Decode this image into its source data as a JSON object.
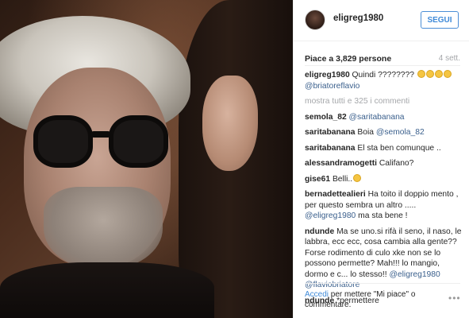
{
  "post": {
    "username": "eligreg1980",
    "follow_label": "SEGUI",
    "likes": "Piace a 3,829 persone",
    "time": "4 sett."
  },
  "comments": {
    "caption": {
      "user": "eligreg1980",
      "text": "Quindi ????????",
      "mention": "@briatoreflavio"
    },
    "more_label": "mostra tutti e 325 i commenti",
    "items": [
      {
        "user": "semola_82",
        "mention": "@saritabanana",
        "text": ""
      },
      {
        "user": "saritabanana",
        "text": "Boia",
        "mention": "@semola_82"
      },
      {
        "user": "saritabanana",
        "text": "El sta ben comunque .."
      },
      {
        "user": "alessandramogetti",
        "text": "Califano?"
      },
      {
        "user": "gise61",
        "text": "Belli.."
      },
      {
        "user": "bernadettealieri",
        "text": "Ha toito il doppio mento , per questo sembra un altro .....",
        "mention": "@eligreg1980",
        "text2": "ma sta bene !"
      },
      {
        "user": "ndunde",
        "text": "Ma se uno.si rifà il seno, il naso, le labbra, ecc ecc, cosa cambia alla gente?? Forse rodimento di culo xke non se lo possono permette? Mah!!! lo mangio, dormo e c... lo stesso!!",
        "mention": "@eligreg1980",
        "mention2": "@flaviobriatore"
      },
      {
        "user": "ndunde",
        "text": "*permettere"
      }
    ]
  },
  "footer": {
    "login": "Accedi",
    "text": "per mettere \"Mi piace\" o commentare.",
    "more_icon": "more-dots-icon"
  },
  "colors": {
    "accent": "#3f8ad8",
    "mention": "#3a5f8c",
    "muted": "#a5a7aa"
  }
}
